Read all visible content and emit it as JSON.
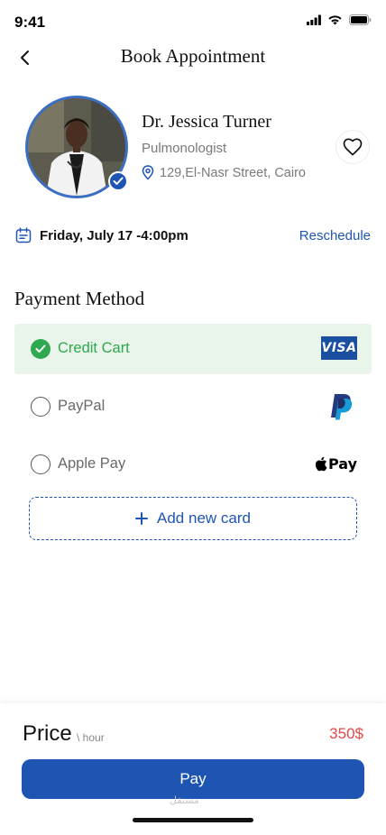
{
  "status_bar": {
    "time": "9:41"
  },
  "header": {
    "title": "Book Appointment"
  },
  "doctor": {
    "name": "Dr. Jessica Turner",
    "specialty": "Pulmonologist",
    "address": "129,El-Nasr Street, Cairo"
  },
  "appointment": {
    "datetime": "Friday, July 17 -4:00pm",
    "reschedule_label": "Reschedule"
  },
  "payment": {
    "section_title": "Payment Method",
    "options": [
      {
        "label": "Credit Cart",
        "selected": true,
        "brand": "VISA"
      },
      {
        "label": "PayPal",
        "selected": false,
        "brand": "paypal-icon"
      },
      {
        "label": "Apple Pay",
        "selected": false,
        "brand": "Pay"
      }
    ],
    "add_card_label": "Add new card"
  },
  "footer": {
    "price_label": "Price",
    "price_unit": "\\ hour",
    "price_value": "350$",
    "pay_label": "Pay",
    "watermark": "مستقل"
  },
  "colors": {
    "primary": "#1e55b3",
    "success": "#2fa84f",
    "selected_bg": "#e9f5ea",
    "price": "#e34848"
  }
}
